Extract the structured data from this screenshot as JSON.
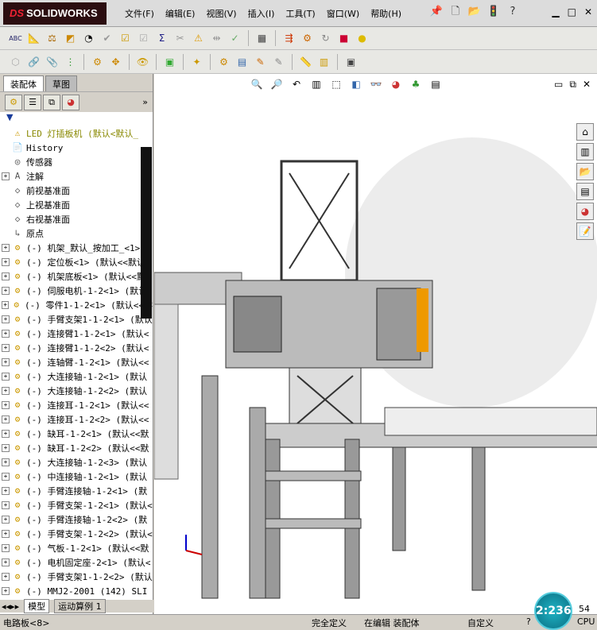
{
  "window": {
    "app_name": "SOLIDWORKS",
    "logo_prefix": "DS"
  },
  "menu": [
    "文件(F)",
    "编辑(E)",
    "视图(V)",
    "插入(I)",
    "工具(T)",
    "窗口(W)",
    "帮助(H)"
  ],
  "title_icons": [
    "pin-icon",
    "new-icon",
    "open-icon",
    "traffic-light-icon",
    "help-icon"
  ],
  "left_tabs": [
    "装配体",
    "草图"
  ],
  "fm_tabs": [
    "feature-tree-icon",
    "property-icon",
    "config-icon",
    "display-icon"
  ],
  "filter_label": "▼",
  "tree": [
    {
      "expand": "",
      "icon": "⚠",
      "label": "LED 灯插板机  (默认<默认_"
    },
    {
      "expand": "",
      "icon": "📄",
      "label": "History"
    },
    {
      "expand": "",
      "icon": "◎",
      "label": "传感器"
    },
    {
      "expand": "+",
      "icon": "A",
      "label": "注解"
    },
    {
      "expand": "",
      "icon": "◇",
      "label": "前视基准面"
    },
    {
      "expand": "",
      "icon": "◇",
      "label": "上视基准面"
    },
    {
      "expand": "",
      "icon": "◇",
      "label": "右视基准面"
    },
    {
      "expand": "",
      "icon": "↳",
      "label": "原点"
    },
    {
      "expand": "+",
      "icon": "⚙",
      "label": "(-) 机架_默认_按加工_<1>"
    },
    {
      "expand": "+",
      "icon": "⚙",
      "label": "(-) 定位板<1> (默认<<默认"
    },
    {
      "expand": "+",
      "icon": "⚙",
      "label": "(-) 机架底板<1> (默认<<默"
    },
    {
      "expand": "+",
      "icon": "⚙",
      "label": "(-) 伺服电机-1-2<1> (默认"
    },
    {
      "expand": "+",
      "icon": "⚙",
      "label": "(-) 零件1-1-2<1> (默认<<零"
    },
    {
      "expand": "+",
      "icon": "⚙",
      "label": "(-) 手臂支架1-1-2<1> (默认"
    },
    {
      "expand": "+",
      "icon": "⚙",
      "label": "(-) 连接臂1-1-2<1> (默认<"
    },
    {
      "expand": "+",
      "icon": "⚙",
      "label": "(-) 连接臂1-1-2<2> (默认<"
    },
    {
      "expand": "+",
      "icon": "⚙",
      "label": "(-) 连轴臂-1-2<1> (默认<<"
    },
    {
      "expand": "+",
      "icon": "⚙",
      "label": "(-) 大连接轴-1-2<1> (默认"
    },
    {
      "expand": "+",
      "icon": "⚙",
      "label": "(-) 大连接轴-1-2<2> (默认"
    },
    {
      "expand": "+",
      "icon": "⚙",
      "label": "(-) 连接耳-1-2<1> (默认<<"
    },
    {
      "expand": "+",
      "icon": "⚙",
      "label": "(-) 连接耳-1-2<2> (默认<<"
    },
    {
      "expand": "+",
      "icon": "⚙",
      "label": "(-) 缺耳-1-2<1> (默认<<默"
    },
    {
      "expand": "+",
      "icon": "⚙",
      "label": "(-) 缺耳-1-2<2> (默认<<默"
    },
    {
      "expand": "+",
      "icon": "⚙",
      "label": "(-) 大连接轴-1-2<3> (默认"
    },
    {
      "expand": "+",
      "icon": "⚙",
      "label": "(-) 中连接轴-1-2<1> (默认"
    },
    {
      "expand": "+",
      "icon": "⚙",
      "label": "(-) 手臂连接轴-1-2<1> (默"
    },
    {
      "expand": "+",
      "icon": "⚙",
      "label": "(-) 手臂支架-1-2<1> (默认<"
    },
    {
      "expand": "+",
      "icon": "⚙",
      "label": "(-) 手臂连接轴-1-2<2> (默"
    },
    {
      "expand": "+",
      "icon": "⚙",
      "label": "(-) 手臂支架-1-2<2> (默认<"
    },
    {
      "expand": "+",
      "icon": "⚙",
      "label": "(-) 气板-1-2<1> (默认<<默"
    },
    {
      "expand": "+",
      "icon": "⚙",
      "label": "(-) 电机固定座-2<1> (默认<"
    },
    {
      "expand": "+",
      "icon": "⚙",
      "label": "(-) 手臂支架1-1-2<2> (默认"
    },
    {
      "expand": "+",
      "icon": "⚙",
      "label": "(-) MMJ2-2001 (142) SLI"
    }
  ],
  "bottom_tabs": [
    "模型",
    "运动算例 1"
  ],
  "status": {
    "left": "电路板<8>",
    "define": "完全定义",
    "editing": "在编辑 装配体",
    "custom": "自定义",
    "help": "?",
    "cpu_value": "54",
    "cpu_label": "CPU"
  },
  "clock": "2:236"
}
